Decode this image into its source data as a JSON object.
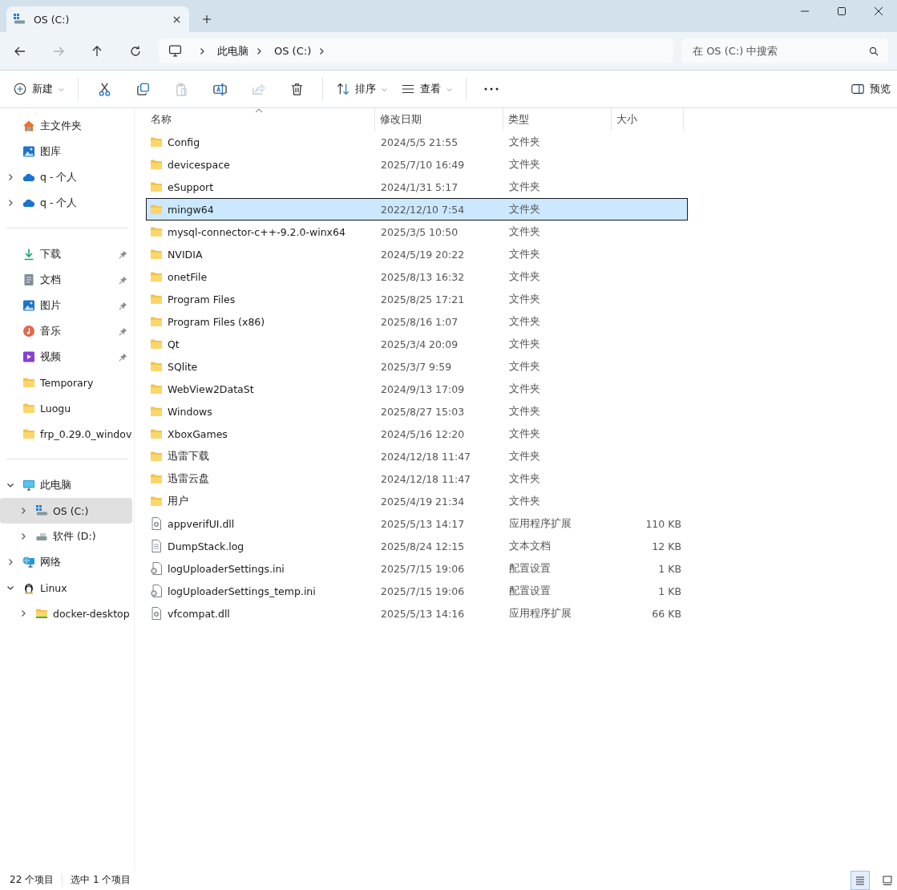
{
  "tab": {
    "title": "OS (C:)"
  },
  "address": {
    "segments": [
      "此电脑",
      "OS (C:)"
    ]
  },
  "search": {
    "placeholder": "在 OS (C:) 中搜索"
  },
  "toolbar": {
    "new": {
      "label": "新建"
    },
    "actions": [
      {
        "kind": "cut",
        "disabled": false
      },
      {
        "kind": "copy",
        "disabled": false
      },
      {
        "kind": "paste",
        "disabled": true
      },
      {
        "kind": "rename",
        "disabled": false
      },
      {
        "kind": "share",
        "disabled": true
      },
      {
        "kind": "delete",
        "disabled": false
      }
    ],
    "sort": {
      "label": "排序"
    },
    "view": {
      "label": "查看"
    },
    "preview": {
      "label": "预览"
    }
  },
  "sidebar": {
    "sections": [
      {
        "items": [
          {
            "label": "主文件夹",
            "kind": "home"
          },
          {
            "label": "图库",
            "kind": "gallery"
          },
          {
            "label": "q - 个人",
            "kind": "cloud",
            "expanded": false
          },
          {
            "label": "q - 个人",
            "kind": "cloud",
            "expanded": false
          }
        ]
      },
      {
        "items": [
          {
            "label": "下载",
            "kind": "download",
            "pinned": true
          },
          {
            "label": "文档",
            "kind": "document",
            "pinned": true
          },
          {
            "label": "图片",
            "kind": "pictures",
            "pinned": true
          },
          {
            "label": "音乐",
            "kind": "music",
            "pinned": true
          },
          {
            "label": "视频",
            "kind": "video",
            "pinned": true
          },
          {
            "label": "Temporary",
            "kind": "folder",
            "pinned": false
          },
          {
            "label": "Luogu",
            "kind": "folder",
            "pinned": false
          },
          {
            "label": "frp_0.29.0_windov",
            "kind": "folder",
            "pinned": false
          }
        ]
      },
      {
        "items": [
          {
            "label": "此电脑",
            "kind": "pc",
            "expanded": true,
            "selected": false,
            "children": [
              {
                "label": "OS (C:)",
                "kind": "drive",
                "expanded": false,
                "selected": true
              },
              {
                "label": "软件 (D:)",
                "kind": "disk",
                "expanded": false,
                "selected": false
              }
            ]
          },
          {
            "label": "网络",
            "kind": "network",
            "expanded": false,
            "selected": false
          },
          {
            "label": "Linux",
            "kind": "linux",
            "expanded": true,
            "selected": false,
            "children": [
              {
                "label": "docker-desktop",
                "kind": "linuxfolder",
                "expanded": false,
                "selected": false
              }
            ]
          }
        ]
      }
    ]
  },
  "table": {
    "columns": [
      {
        "label": "名称",
        "sorted": true
      },
      {
        "label": "修改日期"
      },
      {
        "label": "类型"
      },
      {
        "label": "大小"
      }
    ],
    "rows": [
      {
        "name": "Config",
        "date": "2024/5/5 21:55",
        "type": "文件夹",
        "kind": "folder",
        "selected": false
      },
      {
        "name": "devicespace",
        "date": "2025/7/10 16:49",
        "type": "文件夹",
        "kind": "folder",
        "selected": false
      },
      {
        "name": "eSupport",
        "date": "2024/1/31 5:17",
        "type": "文件夹",
        "kind": "folder",
        "selected": false
      },
      {
        "name": "mingw64",
        "date": "2022/12/10 7:54",
        "type": "文件夹",
        "kind": "folder",
        "selected": true
      },
      {
        "name": "mysql-connector-c++-9.2.0-winx64",
        "date": "2025/3/5 10:50",
        "type": "文件夹",
        "kind": "folder",
        "selected": false
      },
      {
        "name": "NVIDIA",
        "date": "2024/5/19 20:22",
        "type": "文件夹",
        "kind": "folder",
        "selected": false
      },
      {
        "name": "onetFile",
        "date": "2025/8/13 16:32",
        "type": "文件夹",
        "kind": "folder",
        "selected": false
      },
      {
        "name": "Program Files",
        "date": "2025/8/25 17:21",
        "type": "文件夹",
        "kind": "folder",
        "selected": false
      },
      {
        "name": "Program Files (x86)",
        "date": "2025/8/16 1:07",
        "type": "文件夹",
        "kind": "folder",
        "selected": false
      },
      {
        "name": "Qt",
        "date": "2025/3/4 20:09",
        "type": "文件夹",
        "kind": "folder",
        "selected": false
      },
      {
        "name": "SQlite",
        "date": "2025/3/7 9:59",
        "type": "文件夹",
        "kind": "folder",
        "selected": false
      },
      {
        "name": "WebView2DataSt",
        "date": "2024/9/13 17:09",
        "type": "文件夹",
        "kind": "folder",
        "selected": false
      },
      {
        "name": "Windows",
        "date": "2025/8/27 15:03",
        "type": "文件夹",
        "kind": "folder",
        "selected": false
      },
      {
        "name": "XboxGames",
        "date": "2024/5/16 12:20",
        "type": "文件夹",
        "kind": "folder",
        "selected": false
      },
      {
        "name": "迅雷下载",
        "date": "2024/12/18 11:47",
        "type": "文件夹",
        "kind": "folder",
        "selected": false
      },
      {
        "name": "迅雷云盘",
        "date": "2024/12/18 11:47",
        "type": "文件夹",
        "kind": "folder",
        "selected": false
      },
      {
        "name": "用户",
        "date": "2025/4/19 21:34",
        "type": "文件夹",
        "kind": "folder",
        "selected": false
      },
      {
        "name": "appverifUI.dll",
        "date": "2025/5/13 14:17",
        "type": "应用程序扩展",
        "size": "110 KB",
        "kind": "dll",
        "selected": false
      },
      {
        "name": "DumpStack.log",
        "date": "2025/8/24 12:15",
        "type": "文本文档",
        "size": "12 KB",
        "kind": "text",
        "selected": false
      },
      {
        "name": "logUploaderSettings.ini",
        "date": "2025/7/15 19:06",
        "type": "配置设置",
        "size": "1 KB",
        "kind": "config",
        "selected": false
      },
      {
        "name": "logUploaderSettings_temp.ini",
        "date": "2025/7/15 19:06",
        "type": "配置设置",
        "size": "1 KB",
        "kind": "config",
        "selected": false
      },
      {
        "name": "vfcompat.dll",
        "date": "2025/5/13 14:16",
        "type": "应用程序扩展",
        "size": "66 KB",
        "kind": "dll",
        "selected": false
      }
    ]
  },
  "status_bar": {
    "count": "22 个项目",
    "selection": "选中 1 个项目",
    "views": [
      {
        "kind": "details",
        "selected": true
      },
      {
        "kind": "tiles",
        "selected": false
      }
    ]
  }
}
